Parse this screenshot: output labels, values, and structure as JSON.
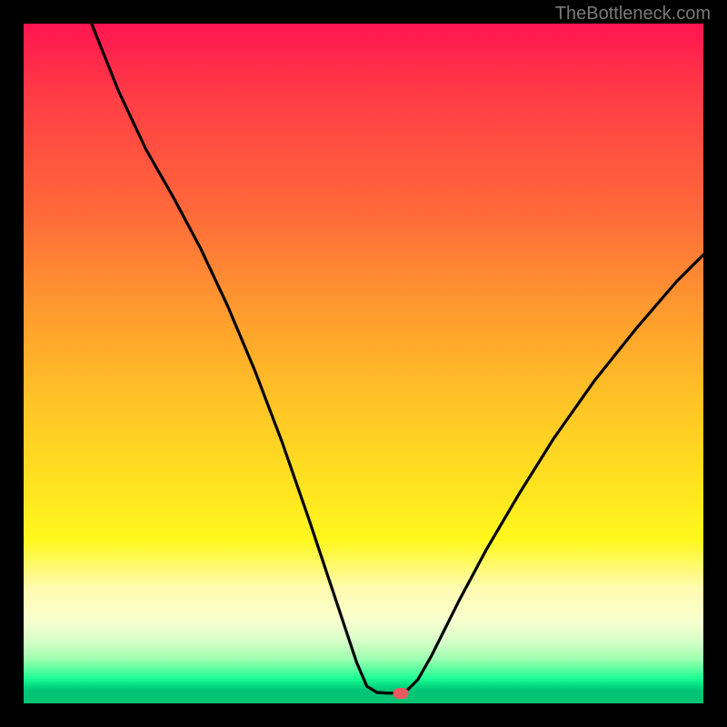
{
  "watermark": "TheBottleneck.com",
  "chart_data": {
    "type": "line",
    "title": "",
    "xlabel": "",
    "ylabel": "",
    "x_range": [
      0,
      100
    ],
    "y_range": [
      0,
      100
    ],
    "curve_points": [
      {
        "x": 10.0,
        "y": 100.0
      },
      {
        "x": 14.0,
        "y": 90.0
      },
      {
        "x": 18.0,
        "y": 81.5
      },
      {
        "x": 22.0,
        "y": 74.5
      },
      {
        "x": 26.0,
        "y": 67.0
      },
      {
        "x": 30.0,
        "y": 58.5
      },
      {
        "x": 34.0,
        "y": 49.0
      },
      {
        "x": 38.0,
        "y": 38.5
      },
      {
        "x": 42.0,
        "y": 27.0
      },
      {
        "x": 46.0,
        "y": 15.0
      },
      {
        "x": 49.0,
        "y": 6.0
      },
      {
        "x": 50.5,
        "y": 2.5
      },
      {
        "x": 52.0,
        "y": 1.6
      },
      {
        "x": 53.5,
        "y": 1.5
      },
      {
        "x": 55.0,
        "y": 1.5
      },
      {
        "x": 56.5,
        "y": 2.0
      },
      {
        "x": 58.0,
        "y": 3.5
      },
      {
        "x": 60.0,
        "y": 7.0
      },
      {
        "x": 64.0,
        "y": 15.0
      },
      {
        "x": 68.0,
        "y": 22.5
      },
      {
        "x": 73.0,
        "y": 31.0
      },
      {
        "x": 78.0,
        "y": 39.0
      },
      {
        "x": 84.0,
        "y": 47.5
      },
      {
        "x": 90.0,
        "y": 55.0
      },
      {
        "x": 96.0,
        "y": 62.0
      },
      {
        "x": 100.0,
        "y": 66.0
      }
    ],
    "marker": {
      "x": 55.5,
      "y": 1.5
    },
    "gradient_stops": [
      {
        "pct": 0,
        "color": "#ff1550"
      },
      {
        "pct": 28,
        "color": "#ff6a3a"
      },
      {
        "pct": 55,
        "color": "#ffc227"
      },
      {
        "pct": 76,
        "color": "#fff81e"
      },
      {
        "pct": 88,
        "color": "#f7ffd0"
      },
      {
        "pct": 95,
        "color": "#5affa0"
      },
      {
        "pct": 100,
        "color": "#02c474"
      }
    ]
  }
}
